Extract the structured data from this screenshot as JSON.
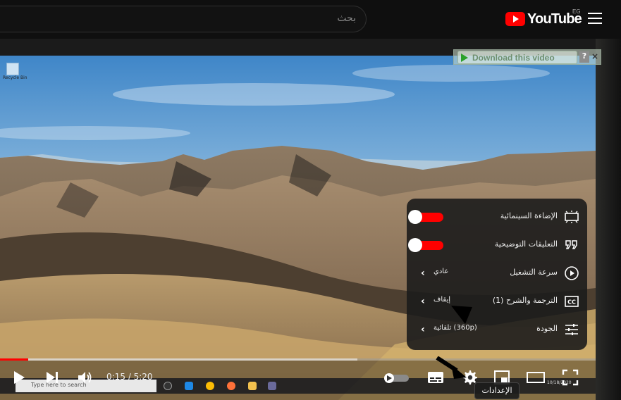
{
  "header": {
    "search_placeholder": "بحث",
    "logo_text": "YouTube",
    "country_code": "EG"
  },
  "overlay": {
    "desktop_icon_label": "Recycle Bin",
    "download_label": "Download this video",
    "download_help": "?",
    "download_close": "×"
  },
  "settings_menu": {
    "rows": [
      {
        "label": "الإضاءة السينمائية",
        "icon": "ambient-mode-icon",
        "toggle_on": true
      },
      {
        "label": "التعليقات التوضيحية",
        "icon": "annotations-icon",
        "toggle_on": true
      },
      {
        "label": "سرعة التشغيل",
        "icon": "playback-speed-icon",
        "value": "عادي"
      },
      {
        "label": "الترجمة والشرح (1)",
        "icon": "subtitles-icon",
        "value": "إيقاف"
      },
      {
        "label": "الجودة",
        "icon": "quality-sliders-icon",
        "value": "تلقائية (360p)"
      }
    ]
  },
  "player": {
    "current_time": "0:15",
    "duration": "5:20",
    "time_display": "0:15 / 5:20",
    "progress_fraction": 0.047,
    "buffer_fraction": 0.6,
    "tooltip": "الإعدادات"
  },
  "taskbar": {
    "search_text": "Type here to search",
    "clock": "10/18/2020"
  },
  "colors": {
    "accent": "#ff0000",
    "background": "#0f0f0f",
    "menu_bg": "#1c1c1c"
  }
}
